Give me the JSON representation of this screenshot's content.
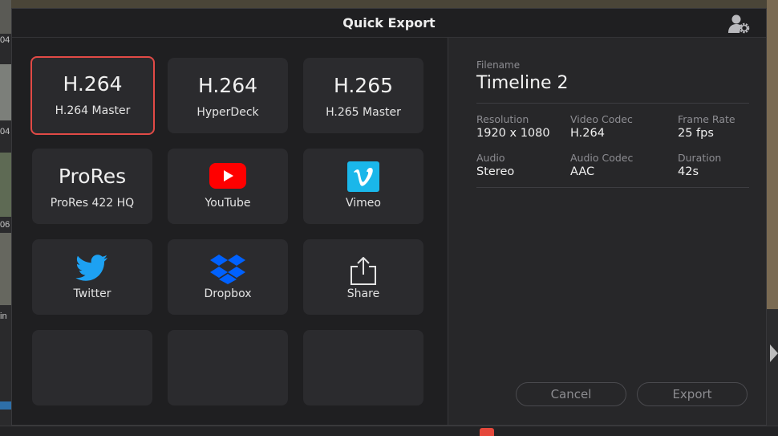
{
  "background": {
    "left_labels": [
      "04",
      "04",
      "06",
      "in"
    ]
  },
  "dialog": {
    "title": "Quick Export",
    "settings_icon": "user-gear-icon"
  },
  "presets": [
    {
      "big": "H.264",
      "label": "H.264 Master",
      "selected": true
    },
    {
      "big": "H.264",
      "label": "HyperDeck",
      "selected": false
    },
    {
      "big": "H.265",
      "label": "H.265 Master",
      "selected": false
    },
    {
      "big": "ProRes",
      "label": "ProRes 422 HQ",
      "selected": false
    },
    {
      "icon": "youtube-icon",
      "label": "YouTube",
      "selected": false
    },
    {
      "icon": "vimeo-icon",
      "label": "Vimeo",
      "selected": false
    },
    {
      "icon": "twitter-icon",
      "label": "Twitter",
      "selected": false
    },
    {
      "icon": "dropbox-icon",
      "label": "Dropbox",
      "selected": false
    },
    {
      "icon": "share-icon",
      "label": "Share",
      "selected": false
    }
  ],
  "details": {
    "filename_label": "Filename",
    "filename": "Timeline 2",
    "resolution_label": "Resolution",
    "resolution": "1920 x 1080",
    "video_codec_label": "Video Codec",
    "video_codec": "H.264",
    "frame_rate_label": "Frame Rate",
    "frame_rate": "25 fps",
    "audio_label": "Audio",
    "audio": "Stereo",
    "audio_codec_label": "Audio Codec",
    "audio_codec": "AAC",
    "duration_label": "Duration",
    "duration": "42s"
  },
  "buttons": {
    "cancel": "Cancel",
    "export": "Export"
  },
  "colors": {
    "selected_border": "#e14a46",
    "youtube_red": "#ff0000",
    "vimeo_blue": "#1ab7ea",
    "twitter_blue": "#1da1f2",
    "dropbox_blue": "#0061fe",
    "playhead": "#e5483b"
  }
}
